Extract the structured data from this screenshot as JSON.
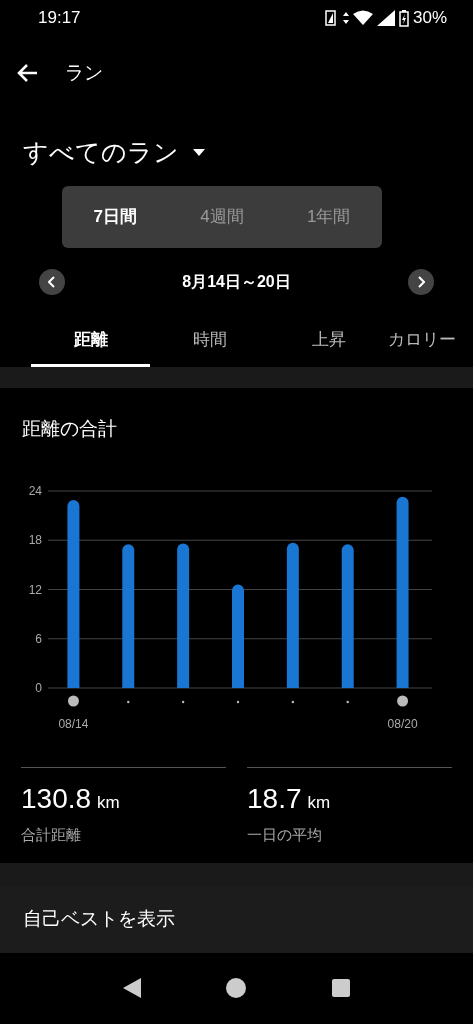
{
  "status_bar": {
    "time": "19:17",
    "battery": "30%"
  },
  "header": {
    "title": "ラン"
  },
  "filter": {
    "label": "すべてのラン"
  },
  "periods": [
    {
      "label": "7日間",
      "selected": true
    },
    {
      "label": "4週間",
      "selected": false
    },
    {
      "label": "1年間",
      "selected": false
    }
  ],
  "date_range": "8月14日～20日",
  "tabs": [
    {
      "label": "距離",
      "selected": true
    },
    {
      "label": "時間",
      "selected": false
    },
    {
      "label": "上昇",
      "selected": false
    },
    {
      "label": "カロリー",
      "selected": false
    }
  ],
  "card": {
    "title": "距離の合計",
    "chart_data": {
      "type": "bar",
      "categories": [
        "08/14",
        null,
        null,
        null,
        null,
        null,
        "08/20"
      ],
      "series": [
        {
          "color": "#1976d2",
          "values": [
            22.9,
            17.5,
            17.6,
            12.6,
            17.7,
            17.5,
            23.3
          ]
        }
      ],
      "ylim": [
        0,
        24
      ],
      "yticks": [
        0,
        6,
        12,
        18,
        24
      ],
      "grid": true
    },
    "stats": [
      {
        "value": "130.8",
        "unit": "km",
        "label": "合計距離"
      },
      {
        "value": "18.7",
        "unit": "km",
        "label": "一日の平均"
      }
    ]
  },
  "personal_best": "自己ベストを表示"
}
